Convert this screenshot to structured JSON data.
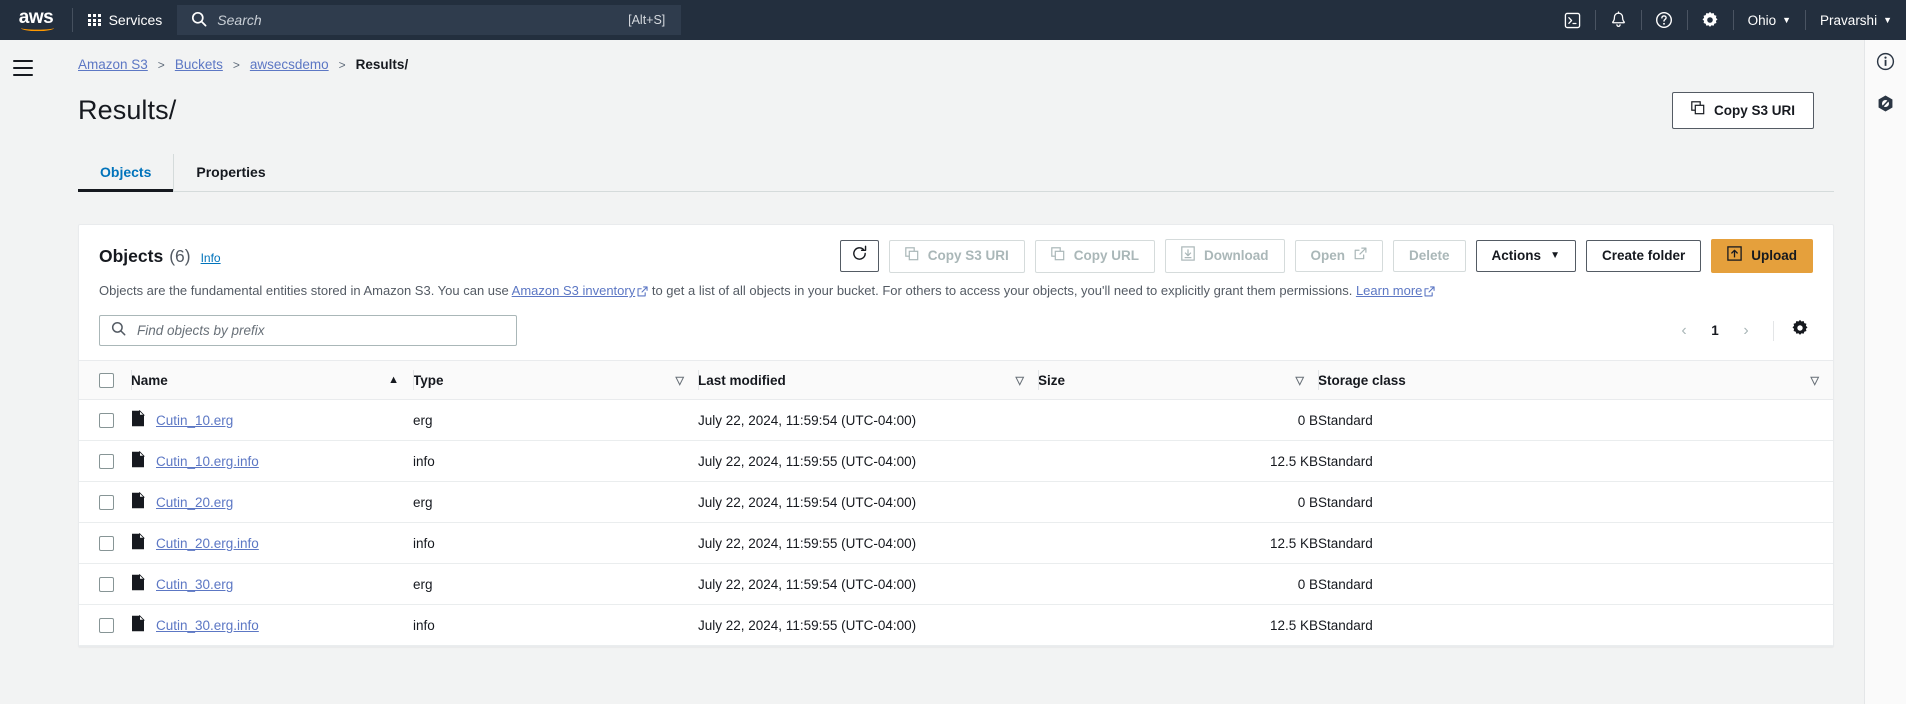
{
  "topnav": {
    "logo": "aws",
    "services_label": "Services",
    "search_placeholder": "Search",
    "search_shortcut": "[Alt+S]",
    "icons": [
      "cloudshell-icon",
      "bell-icon",
      "help-icon",
      "settings-icon"
    ],
    "region": "Ohio",
    "account": "Pravarshi"
  },
  "breadcrumb": {
    "items": [
      {
        "label": "Amazon S3",
        "link": true
      },
      {
        "label": "Buckets",
        "link": true
      },
      {
        "label": "awsecsdemo",
        "link": true
      },
      {
        "label": "Results/",
        "link": false
      }
    ],
    "separator": ">"
  },
  "page": {
    "title": "Results/",
    "copy_uri_button": "Copy S3 URI"
  },
  "tabs": [
    {
      "label": "Objects",
      "active": true
    },
    {
      "label": "Properties",
      "active": false
    }
  ],
  "panel": {
    "title": "Objects",
    "count": "(6)",
    "info_label": "Info",
    "description_part1": "Objects are the fundamental entities stored in Amazon S3. You can use ",
    "description_link1": "Amazon S3 inventory",
    "description_part2": " to get a list of all objects in your bucket. For others to access your objects, you'll need to explicitly grant them permissions. ",
    "description_link2": "Learn more",
    "actions": [
      {
        "label": "Copy S3 URI",
        "icon": "copy-icon",
        "disabled": true
      },
      {
        "label": "Copy URL",
        "icon": "copy-icon",
        "disabled": true
      },
      {
        "label": "Download",
        "icon": "download-icon",
        "disabled": true
      },
      {
        "label": "Open",
        "icon": "external-link-icon",
        "disabled": true
      },
      {
        "label": "Delete",
        "icon": "",
        "disabled": true
      },
      {
        "label": "Actions",
        "icon": "chevron-down-icon",
        "disabled": false
      },
      {
        "label": "Create folder",
        "icon": "",
        "disabled": false
      },
      {
        "label": "Upload",
        "icon": "upload-icon",
        "disabled": false,
        "primary": true
      }
    ],
    "refresh_icon": "refresh-icon",
    "search_placeholder": "Find objects by prefix",
    "search_value": "",
    "pagination": {
      "prev": "‹",
      "page": "1",
      "next": "›"
    },
    "settings_icon": "gear-icon"
  },
  "table": {
    "columns": [
      {
        "label": "Name",
        "sort": "asc"
      },
      {
        "label": "Type",
        "sort": "none"
      },
      {
        "label": "Last modified",
        "sort": "none"
      },
      {
        "label": "Size",
        "sort": "none"
      },
      {
        "label": "Storage class",
        "sort": "none"
      }
    ],
    "rows": [
      {
        "name": "Cutin_10.erg",
        "type": "erg",
        "modified": "July 22, 2024, 11:59:54 (UTC-04:00)",
        "size": "0 B",
        "storage": "Standard"
      },
      {
        "name": "Cutin_10.erg.info",
        "type": "info",
        "modified": "July 22, 2024, 11:59:55 (UTC-04:00)",
        "size": "12.5 KB",
        "storage": "Standard"
      },
      {
        "name": "Cutin_20.erg",
        "type": "erg",
        "modified": "July 22, 2024, 11:59:54 (UTC-04:00)",
        "size": "0 B",
        "storage": "Standard"
      },
      {
        "name": "Cutin_20.erg.info",
        "type": "info",
        "modified": "July 22, 2024, 11:59:55 (UTC-04:00)",
        "size": "12.5 KB",
        "storage": "Standard"
      },
      {
        "name": "Cutin_30.erg",
        "type": "erg",
        "modified": "July 22, 2024, 11:59:54 (UTC-04:00)",
        "size": "0 B",
        "storage": "Standard"
      },
      {
        "name": "Cutin_30.erg.info",
        "type": "info",
        "modified": "July 22, 2024, 11:59:55 (UTC-04:00)",
        "size": "12.5 KB",
        "storage": "Standard"
      }
    ]
  },
  "right_rail": {
    "icons": [
      "info-icon",
      "aws-app-icon"
    ]
  },
  "colors": {
    "nav_bg": "#232f3e",
    "accent_orange": "#e5a03c",
    "link_blue": "#5c77c4",
    "tab_active_blue": "#0073bb",
    "page_bg": "#f2f3f3"
  }
}
